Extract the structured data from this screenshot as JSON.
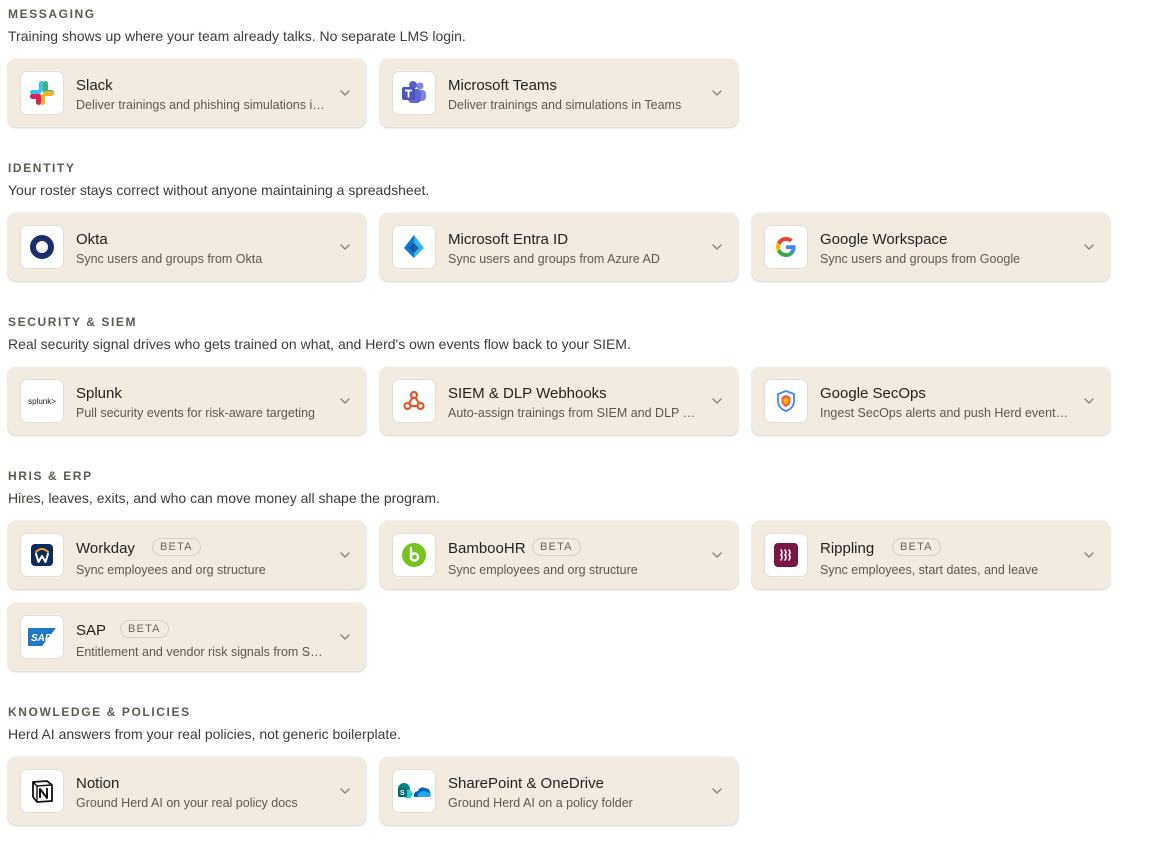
{
  "sections": {
    "messaging": {
      "title": "MESSAGING",
      "subtitle": "Training shows up where your team already talks. No separate LMS login.",
      "cards": [
        {
          "name": "Slack",
          "desc": "Deliver trainings and phishing simulations in Slack",
          "icon": "slack-icon"
        },
        {
          "name": "Microsoft Teams",
          "desc": "Deliver trainings and simulations in Teams",
          "icon": "microsoft-teams-icon"
        }
      ]
    },
    "identity": {
      "title": "IDENTITY",
      "subtitle": "Your roster stays correct without anyone maintaining a spreadsheet.",
      "cards": [
        {
          "name": "Okta",
          "desc": "Sync users and groups from Okta",
          "icon": "okta-icon"
        },
        {
          "name": "Microsoft Entra ID",
          "desc": "Sync users and groups from Azure AD",
          "icon": "entra-id-icon"
        },
        {
          "name": "Google Workspace",
          "desc": "Sync users and groups from Google",
          "icon": "google-icon"
        }
      ]
    },
    "security": {
      "title": "SECURITY & SIEM",
      "subtitle": "Real security signal drives who gets trained on what, and Herd's own events flow back to your SIEM.",
      "cards": [
        {
          "name": "Splunk",
          "desc": "Pull security events for risk-aware targeting",
          "icon": "splunk-icon",
          "logo_text": "splunk>"
        },
        {
          "name": "SIEM & DLP Webhooks",
          "desc": "Auto-assign trainings from SIEM and DLP alerts",
          "icon": "webhook-icon"
        },
        {
          "name": "Google SecOps",
          "desc": "Ingest SecOps alerts and push Herd events back",
          "icon": "google-secops-shield-icon"
        }
      ]
    },
    "hris": {
      "title": "HRIS & ERP",
      "subtitle": "Hires, leaves, exits, and who can move money all shape the program.",
      "cards": [
        {
          "name": "Workday",
          "badge": "BETA",
          "desc": "Sync employees and org structure",
          "icon": "workday-icon"
        },
        {
          "name": "BambooHR",
          "badge": "BETA",
          "desc": "Sync employees and org structure",
          "icon": "bamboohr-icon"
        },
        {
          "name": "Rippling",
          "badge": "BETA",
          "desc": "Sync employees, start dates, and leave",
          "icon": "rippling-icon"
        },
        {
          "name": "SAP",
          "badge": "BETA",
          "desc": "Entitlement and vendor risk signals from SAP",
          "icon": "sap-icon",
          "logo_text": "SAP"
        }
      ]
    },
    "knowledge": {
      "title": "KNOWLEDGE & POLICIES",
      "subtitle": "Herd AI answers from your real policies, not generic boilerplate.",
      "cards": [
        {
          "name": "Notion",
          "desc": "Ground Herd AI on your real policy docs",
          "icon": "notion-icon"
        },
        {
          "name": "SharePoint & OneDrive",
          "desc": "Ground Herd AI on a policy folder",
          "icon": "sharepoint-onedrive-icon"
        }
      ]
    }
  },
  "colors": {
    "card_bg": "#f3ebdf",
    "slack": [
      "#36c5f0",
      "#2eb67d",
      "#ecb22e",
      "#e01e5a"
    ],
    "teams": "#5b5fc7",
    "okta": "#1a2f6b",
    "entra": "#0f78d4",
    "webhook": "#e0592a",
    "workday": "#0b2d5c",
    "bamboohr": "#73c41d",
    "rippling": "#7a1548",
    "sap": "#1f77c9"
  }
}
